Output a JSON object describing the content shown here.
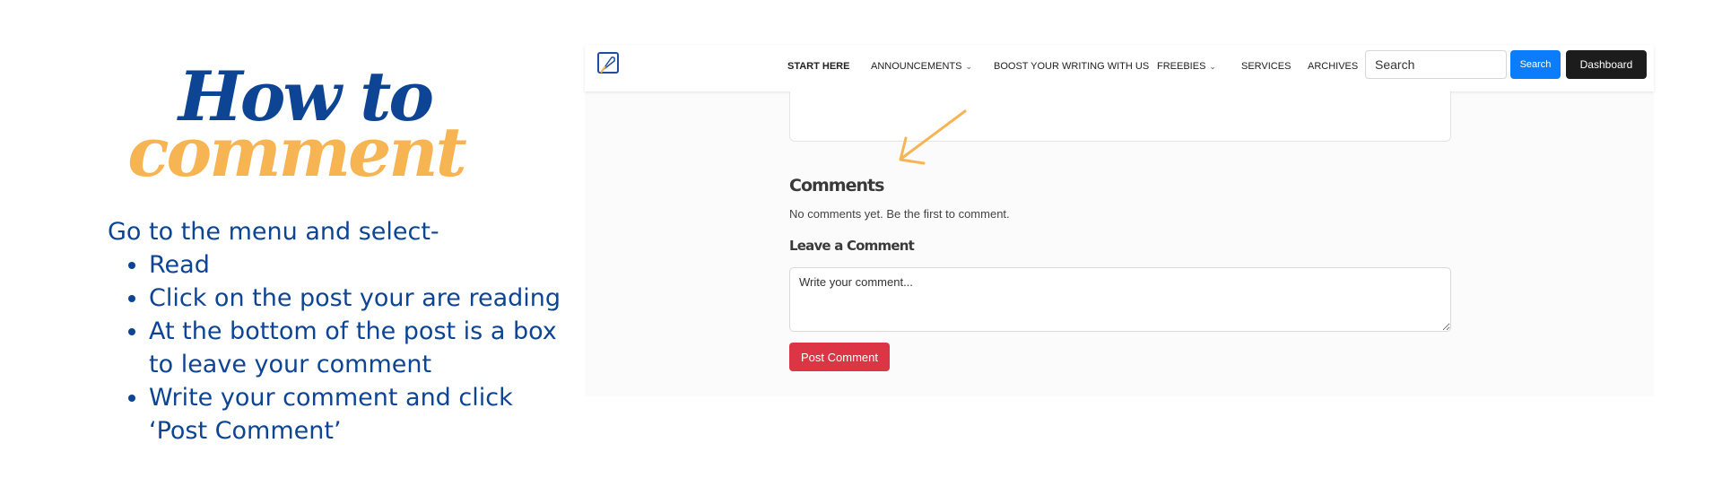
{
  "instructions": {
    "title_line1": "How to",
    "title_line2": "comment",
    "intro": "Go to the menu and select-",
    "steps": [
      "Read",
      "Click on the post your are reading",
      "At the bottom of the post is a box to leave your comment",
      "Write your comment and click ‘Post Comment’"
    ],
    "colors": {
      "title_blue": "#0d4493",
      "title_orange": "#f7b452",
      "text_blue": "#0d4493"
    }
  },
  "navbar": {
    "logo_icon": "quill-logo-icon",
    "items": [
      {
        "label": "START HERE",
        "dropdown": false,
        "active": true
      },
      {
        "label": "ANNOUNCEMENTS",
        "dropdown": true,
        "active": false
      },
      {
        "label": "BOOST YOUR WRITING WITH US",
        "dropdown": false,
        "active": false
      },
      {
        "label": "FREEBIES",
        "dropdown": true,
        "active": false
      },
      {
        "label": "SERVICES",
        "dropdown": false,
        "active": false
      },
      {
        "label": "ARCHIVES",
        "dropdown": false,
        "active": false
      }
    ],
    "search_placeholder": "Search",
    "search_button": "Search",
    "dashboard_button": "Dashboard",
    "colors": {
      "search_button": "#0b7dfb",
      "dashboard_button": "#1c1c1c"
    }
  },
  "comments_section": {
    "heading": "Comments",
    "empty_text": "No comments yet. Be the first to comment.",
    "leave_heading": "Leave a Comment",
    "textarea_placeholder": "Write your comment...",
    "post_button": "Post Comment",
    "post_button_color": "#dc3545",
    "annotation_arrow_color": "#f7b452"
  }
}
